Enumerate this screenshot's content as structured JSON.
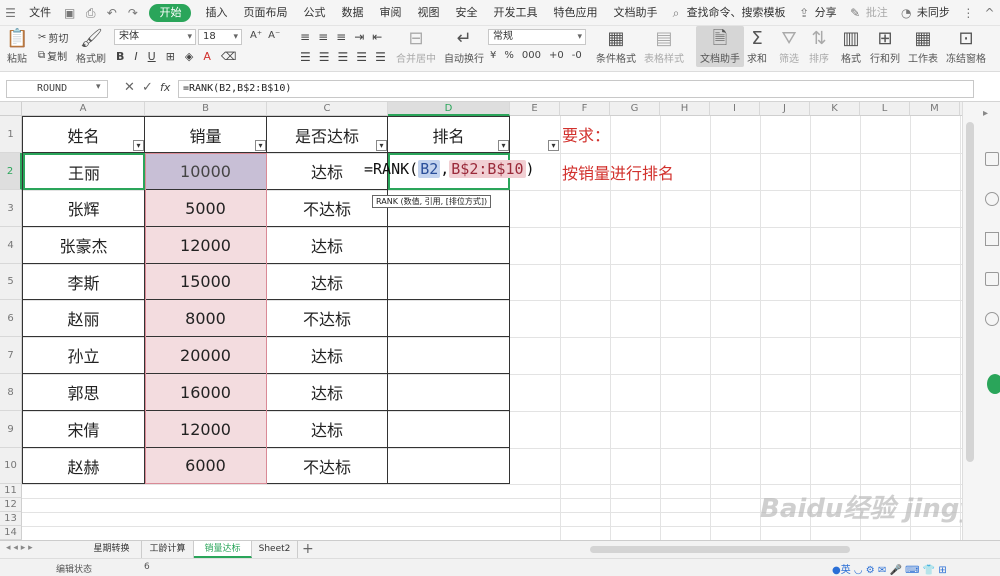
{
  "menubar": {
    "file": "文件",
    "items": [
      "开始",
      "插入",
      "页面布局",
      "公式",
      "数据",
      "审阅",
      "视图",
      "安全",
      "开发工具",
      "特色应用",
      "文档助手"
    ],
    "search": "查找命令、搜索模板",
    "share": "分享",
    "comment": "批注",
    "sync": "未同步"
  },
  "ribbon": {
    "paste": "粘贴",
    "cut": "剪切",
    "copy": "复制",
    "format_painter": "格式刷",
    "font": "宋体",
    "size": "18",
    "merge": "合并居中",
    "wrap": "自动换行",
    "number_format": "常规",
    "cond_format": "条件格式",
    "table_style": "表格样式",
    "doc_helper": "文档助手",
    "sum": "求和",
    "filter": "筛选",
    "sort": "排序",
    "cell_format": "格式",
    "row_col": "行和列",
    "sheet": "工作表",
    "freeze": "冻结窗格"
  },
  "formula_bar": {
    "name_box": "ROUND",
    "fx": "fx",
    "formula": "=RANK(B2,B$2:B$10)"
  },
  "columns": [
    "A",
    "B",
    "C",
    "D",
    "E",
    "F",
    "G",
    "H",
    "I",
    "J",
    "K",
    "L",
    "M",
    "N"
  ],
  "rows": [
    "1",
    "2",
    "3",
    "4",
    "5",
    "6",
    "7",
    "8",
    "9",
    "10",
    "11",
    "12",
    "13",
    "14"
  ],
  "table": {
    "headers": [
      "姓名",
      "销量",
      "是否达标",
      "排名"
    ],
    "names": [
      "王丽",
      "张辉",
      "张豪杰",
      "李斯",
      "赵丽",
      "孙立",
      "郭思",
      "宋倩",
      "赵赫"
    ],
    "sales": [
      "10000",
      "5000",
      "12000",
      "15000",
      "8000",
      "20000",
      "16000",
      "12000",
      "6000"
    ],
    "status": [
      "达标",
      "不达标",
      "达标",
      "达标",
      "不达标",
      "达标",
      "达标",
      "达标",
      "不达标"
    ]
  },
  "editing": {
    "prefix": "=RANK(",
    "ref1": "B2",
    "comma": ",",
    "ref2": "B$2:B$10",
    "suffix": ")",
    "tooltip": "RANK (数值, 引用, [排位方式])"
  },
  "notes": {
    "title": "要求：",
    "body": "按销量进行排名"
  },
  "tabs": [
    "星期转换",
    "工龄计算",
    "销量达标",
    "Sheet2"
  ],
  "status": {
    "mode": "编辑状态",
    "count": "6"
  },
  "watermark": "Baidu经验 jingyan.baidu.com",
  "colors": {
    "accent": "#2aa55a",
    "pink": "#f3dcdf",
    "red": "#d2312d"
  }
}
